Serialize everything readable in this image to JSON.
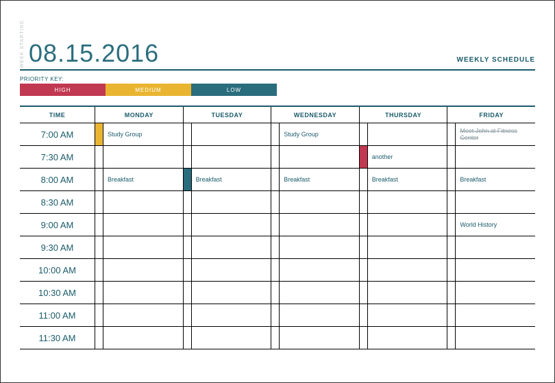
{
  "header": {
    "week_starting_label": "WEEK STARTING",
    "date": "08.15.2016",
    "title": "WEEKLY SCHEDULE"
  },
  "priority": {
    "label": "PRIORITY KEY:",
    "high": "HIGH",
    "medium": "MEDIUM",
    "low": "LOW"
  },
  "columns": {
    "time": "TIME",
    "days": [
      "MONDAY",
      "TUESDAY",
      "WEDNESDAY",
      "THURSDAY",
      "FRIDAY"
    ]
  },
  "times": [
    "7:00 AM",
    "7:30 AM",
    "8:00 AM",
    "8:30 AM",
    "9:00 AM",
    "9:30 AM",
    "10:00 AM",
    "10:30 AM",
    "11:00 AM",
    "11:30 AM"
  ],
  "cells": {
    "r0": {
      "d0": {
        "text": "Study Group",
        "priority": "medium"
      },
      "d2": {
        "text": "Study Group"
      },
      "d4": {
        "text": "Meet John at Fitness Center",
        "strike": true
      }
    },
    "r1": {
      "d3": {
        "text": "another",
        "priority": "high"
      }
    },
    "r2": {
      "d0": {
        "text": "Breakfast"
      },
      "d1": {
        "text": "Breakfast",
        "priority": "low"
      },
      "d2": {
        "text": "Breakfast"
      },
      "d3": {
        "text": "Breakfast"
      },
      "d4": {
        "text": "Breakfast"
      }
    },
    "r4": {
      "d4": {
        "text": "World History"
      }
    }
  },
  "colors": {
    "accent": "#2a6d7d",
    "high": "#c13851",
    "medium": "#e9b531",
    "low": "#2a6d7d"
  }
}
